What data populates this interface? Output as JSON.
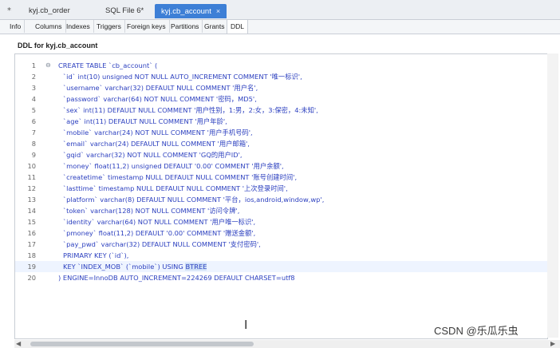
{
  "file_tabs": {
    "pin_icon": "pin-icon",
    "items": [
      {
        "label": "kyj.cb_order"
      },
      {
        "label": "SQL File 6*"
      },
      {
        "label": "kyj.cb_account",
        "close": "×"
      }
    ]
  },
  "sub_tabs": [
    "Info",
    "Columns",
    "Indexes",
    "Triggers",
    "Foreign keys",
    "Partitions",
    "Grants",
    "DDL"
  ],
  "ddl_title": "DDL for kyj.cb_account",
  "fold_glyph": "⊖",
  "ddl_lines": [
    {
      "n": "1",
      "text": "CREATE TABLE `cb_account` ("
    },
    {
      "n": "2",
      "text": "`id` int(10) unsigned NOT NULL AUTO_INCREMENT COMMENT '唯一标识',"
    },
    {
      "n": "3",
      "text": "`username` varchar(32) DEFAULT NULL COMMENT '用户名',"
    },
    {
      "n": "4",
      "text": "`password` varchar(64) NOT NULL COMMENT '密码，MD5',"
    },
    {
      "n": "5",
      "text": "`sex` int(11) DEFAULT NULL COMMENT '用户性别，1:男，2:女，3:保密，4:未知',"
    },
    {
      "n": "6",
      "text": "`age` int(11) DEFAULT NULL COMMENT '用户年龄',"
    },
    {
      "n": "7",
      "text": "`mobile` varchar(24) NOT NULL COMMENT '用户手机号码',"
    },
    {
      "n": "8",
      "text": "`email` varchar(24) DEFAULT NULL COMMENT '用户邮箱',"
    },
    {
      "n": "9",
      "text": "`gqid` varchar(32) NOT NULL COMMENT 'GQ的用户ID',"
    },
    {
      "n": "10",
      "text": "`money` float(11,2) unsigned DEFAULT '0.00' COMMENT '用户余额',"
    },
    {
      "n": "11",
      "text": "`createtime` timestamp NULL DEFAULT NULL COMMENT '账号创建时间',"
    },
    {
      "n": "12",
      "text": "`lasttime` timestamp NULL DEFAULT NULL COMMENT '上次登录时间',"
    },
    {
      "n": "13",
      "text": "`platform` varchar(8) DEFAULT NULL COMMENT '平台，ios,android,window,wp',"
    },
    {
      "n": "14",
      "text": "`token` varchar(128) NOT NULL COMMENT '访问令牌',"
    },
    {
      "n": "15",
      "text": "`identity` varchar(64) NOT NULL COMMENT '用户唯一标识',"
    },
    {
      "n": "16",
      "text": "`pmoney` float(11,2) DEFAULT '0.00' COMMENT '赠送金额',"
    },
    {
      "n": "17",
      "text": "`pay_pwd` varchar(32) DEFAULT NULL COMMENT '支付密码',"
    },
    {
      "n": "18",
      "text": "PRIMARY KEY (`id`),"
    },
    {
      "n": "19",
      "text": "KEY `INDEX_MOB` (`mobile`) USING ",
      "highlight": "BTREE"
    },
    {
      "n": "20",
      "text": ") ENGINE=InnoDB AUTO_INCREMENT=224269 DEFAULT CHARSET=utf8"
    }
  ],
  "scroll_arrows": {
    "left": "◀",
    "right": "▶"
  },
  "ibeam_glyph": "I",
  "watermark": "CSDN @乐瓜乐虫",
  "colors": {
    "active_tab": "#3d7fd6",
    "code_text": "#2b3fbf"
  }
}
